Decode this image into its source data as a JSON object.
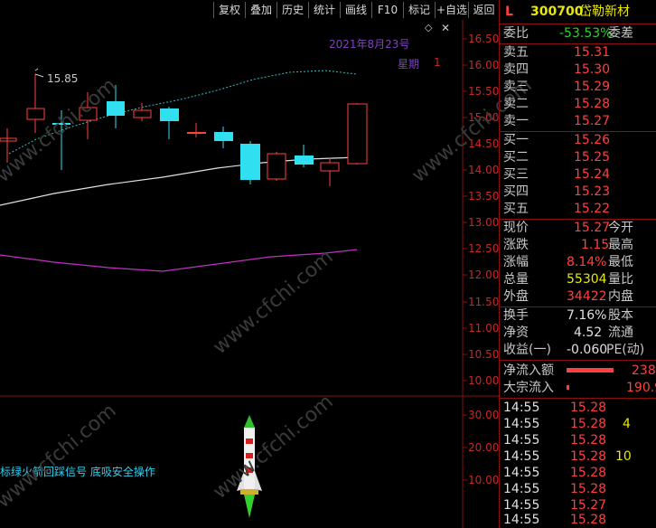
{
  "toolbar": {
    "items": [
      "复权",
      "叠加",
      "历史",
      "统计",
      "画线",
      "F10",
      "标记",
      "+自选",
      "返回"
    ]
  },
  "chart": {
    "date_label": "2021年8月23号",
    "weekday_label": "星期",
    "weekday_value": "1",
    "high_marker": "15.85",
    "price_axis": [
      "16.50",
      "16.00",
      "15.50",
      "15.00",
      "14.50",
      "14.00",
      "13.50",
      "13.00",
      "12.50",
      "12.00",
      "11.50",
      "11.00",
      "10.50",
      "10.00"
    ],
    "indicator_axis": [
      "30.00",
      "20.00",
      "10.00"
    ],
    "signal_text": "标绿火箭回踩信号 底吸安全操作",
    "watermark": "www.cfchi.com",
    "diamond_icon": "diamond-icon",
    "close_icon": "close-icon",
    "colors": {
      "up": "#ff4040",
      "down": "#30e0f0",
      "ma_white": "#e0e0e0",
      "ma_cyan": "#30c0c0",
      "ma_purple": "#c030c0"
    }
  },
  "quote": {
    "tag": "L",
    "code": "300700",
    "name": "岱勒新材",
    "weibi_label": "委比",
    "weibi_value": "-53.53%",
    "weicha_label": "委差",
    "sell": [
      {
        "label": "卖五",
        "price": "15.31"
      },
      {
        "label": "卖四",
        "price": "15.30"
      },
      {
        "label": "卖三",
        "price": "15.29"
      },
      {
        "label": "卖二",
        "price": "15.28"
      },
      {
        "label": "卖一",
        "price": "15.27"
      }
    ],
    "buy": [
      {
        "label": "买一",
        "price": "15.26"
      },
      {
        "label": "买二",
        "price": "15.25"
      },
      {
        "label": "买三",
        "price": "15.24"
      },
      {
        "label": "买四",
        "price": "15.23"
      },
      {
        "label": "买五",
        "price": "15.22"
      }
    ],
    "stats": [
      {
        "l": "现价",
        "v": "15.27",
        "r": "今开"
      },
      {
        "l": "涨跌",
        "v": "1.15",
        "r": "最高"
      },
      {
        "l": "涨幅",
        "v": "8.14%",
        "r": "最低"
      },
      {
        "l": "总量",
        "v": "55304",
        "r": "量比"
      },
      {
        "l": "外盘",
        "v": "34422",
        "r": "内盘"
      }
    ],
    "stats2": [
      {
        "l": "换手",
        "v": "7.16%",
        "r": "股本"
      },
      {
        "l": "净资",
        "v": "4.52",
        "r": "流通"
      },
      {
        "l": "收益(一)",
        "v": "-0.060",
        "r": "PE(动)"
      }
    ],
    "flow": [
      {
        "l": "净流入额",
        "v": "238"
      },
      {
        "l": "大宗流入",
        "v": "190.9"
      }
    ],
    "ticks": [
      {
        "t": "14:55",
        "p": "15.28",
        "v": ""
      },
      {
        "t": "14:55",
        "p": "15.28",
        "v": "4"
      },
      {
        "t": "14:55",
        "p": "15.28",
        "v": ""
      },
      {
        "t": "14:55",
        "p": "15.28",
        "v": "10"
      },
      {
        "t": "14:55",
        "p": "15.28",
        "v": ""
      },
      {
        "t": "14:55",
        "p": "15.28",
        "v": ""
      },
      {
        "t": "14:55",
        "p": "15.27",
        "v": ""
      },
      {
        "t": "14:55",
        "p": "15.28",
        "v": ""
      }
    ]
  }
}
